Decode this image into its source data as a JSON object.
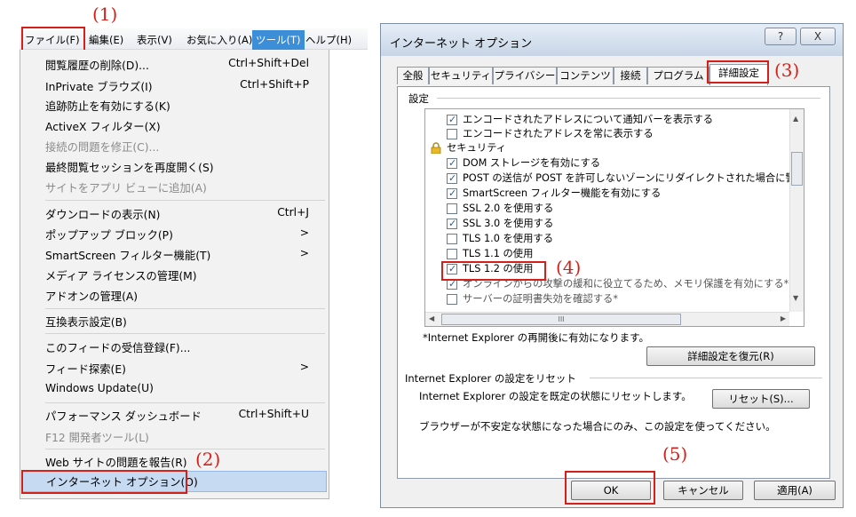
{
  "steps": {
    "s1": "(1)",
    "s2": "(2)",
    "s3": "(3)",
    "s4": "(4)",
    "s5": "(5)"
  },
  "menubar": [
    "ファイル(F)",
    "編集(E)",
    "表示(V)",
    "お気に入り(A)",
    "ツール(T)",
    "ヘルプ(H)"
  ],
  "menu": [
    {
      "label": "閲覧履歴の削除(D)...",
      "shortcut": "Ctrl+Shift+Del"
    },
    {
      "label": "InPrivate ブラウズ(I)",
      "shortcut": "Ctrl+Shift+P"
    },
    {
      "label": "追跡防止を有効にする(K)",
      "shortcut": ""
    },
    {
      "label": "ActiveX フィルター(X)",
      "shortcut": ""
    },
    {
      "label": "接続の問題を修正(C)...",
      "shortcut": ""
    },
    {
      "label": "最終閲覧セッションを再度開く(S)",
      "shortcut": ""
    },
    {
      "label": "サイトをアプリ ビューに追加(A)",
      "shortcut": ""
    },
    {
      "label": "ダウンロードの表示(N)",
      "shortcut": "Ctrl+J"
    },
    {
      "label": "ポップアップ ブロック(P)",
      "shortcut": ">"
    },
    {
      "label": "SmartScreen フィルター機能(T)",
      "shortcut": ">"
    },
    {
      "label": "メディア ライセンスの管理(M)",
      "shortcut": ""
    },
    {
      "label": "アドオンの管理(A)",
      "shortcut": ""
    },
    {
      "label": "互換表示設定(B)",
      "shortcut": ""
    },
    {
      "label": "このフィードの受信登録(F)...",
      "shortcut": ""
    },
    {
      "label": "フィード探索(E)",
      "shortcut": ">"
    },
    {
      "label": "Windows Update(U)",
      "shortcut": ""
    },
    {
      "label": "パフォーマンス ダッシュボード",
      "shortcut": "Ctrl+Shift+U"
    },
    {
      "label": "F12 開発者ツール(L)",
      "shortcut": ""
    },
    {
      "label": "Web サイトの問題を報告(R)",
      "shortcut": ""
    },
    {
      "label": "インターネット オプション(O)",
      "shortcut": ""
    }
  ],
  "dialog": {
    "title": "インターネット オプション",
    "help": "?",
    "close": "X",
    "tabs": [
      "全般",
      "セキュリティ",
      "プライバシー",
      "コンテンツ",
      "接続",
      "プログラム",
      "詳細設定"
    ],
    "group_settings": "設定",
    "items": [
      {
        "text": "エンコードされたアドレスについて通知バーを表示する",
        "checked": true
      },
      {
        "text": "エンコードされたアドレスを常に表示する",
        "checked": false
      },
      {
        "text": "セキュリティ",
        "checked": null
      },
      {
        "text": "DOM ストレージを有効にする",
        "checked": true
      },
      {
        "text": "POST の送信が POST を許可しないゾーンにリダイレクトされた場合に警",
        "checked": true
      },
      {
        "text": "SmartScreen フィルター機能を有効にする",
        "checked": true
      },
      {
        "text": "SSL 2.0 を使用する",
        "checked": false
      },
      {
        "text": "SSL 3.0 を使用する",
        "checked": true
      },
      {
        "text": "TLS 1.0 を使用する",
        "checked": false
      },
      {
        "text": "TLS 1.1 の使用",
        "checked": false
      },
      {
        "text": "TLS 1.2 の使用",
        "checked": true
      },
      {
        "text": "オンラインからの攻撃の緩和に役立てるため、メモリ保護を有効にする*",
        "checked": true
      },
      {
        "text": "サーバーの証明書失効を確認する*",
        "checked": false
      }
    ],
    "hscroll_grip": "III",
    "restart_note": "*Internet Explorer の再開後に有効になります。",
    "restore_button": "詳細設定を復元(R)",
    "reset_group": "Internet Explorer の設定をリセット",
    "reset_desc": "Internet Explorer の設定を既定の状態にリセットします。",
    "reset_button": "リセット(S)...",
    "reset_note": "ブラウザーが不安定な状態になった場合にのみ、この設定を使ってください。",
    "ok": "OK",
    "cancel": "キャンセル",
    "apply": "適用(A)"
  }
}
